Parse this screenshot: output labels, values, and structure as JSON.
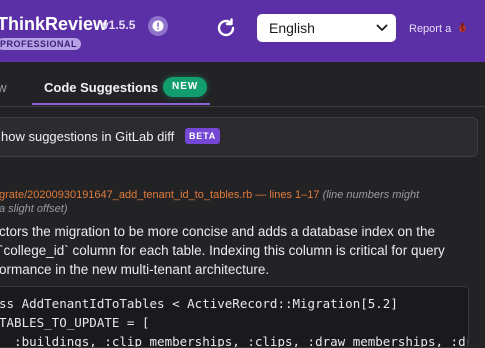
{
  "header": {
    "brand": "ThinkReview",
    "version": "v1.5.5",
    "badge": "PROFESSIONAL",
    "info_icon": "info-icon",
    "refresh_icon": "refresh-icon",
    "language": "English",
    "report_label": "Report a",
    "bug_icon": "bug-icon",
    "colors": {
      "header_bg": "#5b2fa5",
      "badge_bg": "#b7a0e3"
    }
  },
  "tabs": {
    "previous_partial": "ew",
    "active_label": "Code Suggestions",
    "new_badge": "NEW",
    "colors": {
      "new_badge": "#129e6d",
      "underline": "#8b63d8"
    }
  },
  "toggle": {
    "label": "how suggestions in GitLab diff",
    "beta_badge": "BETA"
  },
  "suggestion": {
    "file_ref": "grate/20200930191647_add_tenant_id_to_tables.rb — lines 1–17",
    "file_note": "(line numbers might",
    "file_note_2": "a slight offset)",
    "desc_line_1": "ctors the migration to be more concise and adds a database index on the",
    "desc_line_2": "`college_id` column for each table. Indexing this column is critical for query",
    "desc_line_3": "ormance in the new multi-tenant architecture.",
    "code_line_1": "ss AddTenantIdToTables < ActiveRecord::Migration[5.2]",
    "code_line_2": "TABLES_TO_UPDATE = [",
    "code_line_3": "  :buildings, :clip_memberships, :clips, :draw_memberships, :draw"
  }
}
